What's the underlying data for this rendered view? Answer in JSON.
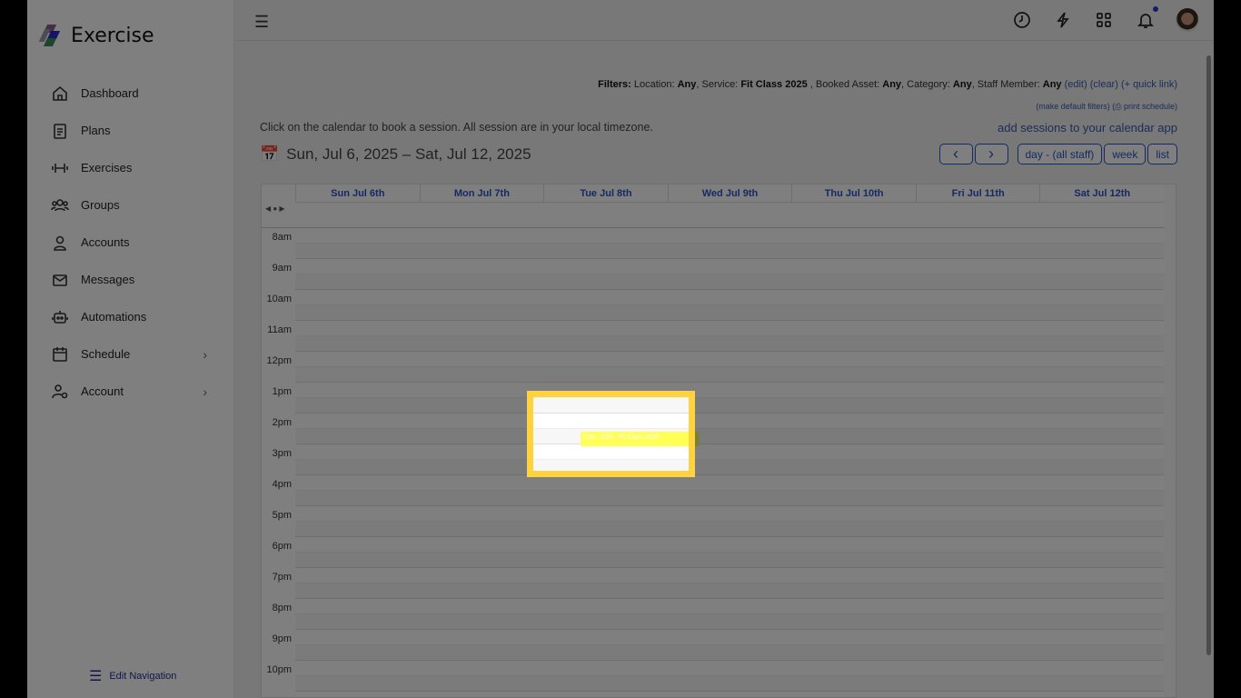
{
  "app": {
    "name": "Exercise"
  },
  "sidebar": {
    "items": [
      {
        "label": "Dashboard"
      },
      {
        "label": "Plans"
      },
      {
        "label": "Exercises"
      },
      {
        "label": "Groups"
      },
      {
        "label": "Accounts"
      },
      {
        "label": "Messages"
      },
      {
        "label": "Automations"
      },
      {
        "label": "Schedule"
      },
      {
        "label": "Account"
      }
    ],
    "edit_nav": "Edit Navigation"
  },
  "filters": {
    "label": "Filters:",
    "location_label": "Location:",
    "location": "Any",
    "service_label": ", Service:",
    "service": "Fit Class 2025",
    "asset_label": " , Booked Asset:",
    "asset": "Any",
    "category_label": ", Category:",
    "category": "Any",
    "staff_label": ", Staff Member:",
    "staff": "Any",
    "edit": "(edit)",
    "clear": "(clear)",
    "quick_link": "(+ quick link)",
    "make_default": "(make default filters)",
    "print": "(⎙ print schedule)"
  },
  "hint": "Click on the calendar to book a session. All session are in your local timezone.",
  "add_sessions": "add sessions to your calendar app",
  "range": "Sun, Jul 6, 2025 – Sat, Jul 12, 2025",
  "buttons": {
    "prev": "‹",
    "next": "›",
    "day": "day - (all staff)",
    "week": "week",
    "list": "list"
  },
  "days": [
    "Sun Jul 6th",
    "Mon Jul 7th",
    "Tue Jul 8th",
    "Wed Jul 9th",
    "Thu Jul 10th",
    "Fri Jul 11th",
    "Sat Jul 12th"
  ],
  "hours": [
    "8am",
    "9am",
    "10am",
    "11am",
    "12pm",
    "1pm",
    "2pm",
    "3pm",
    "4pm",
    "5pm",
    "6pm",
    "7pm",
    "8pm",
    "9pm",
    "10pm"
  ],
  "event": {
    "text": "2:30 - 3:00 - Fit Class 2025",
    "color": "#ffff55"
  },
  "highlight_color": "#ffd23f"
}
